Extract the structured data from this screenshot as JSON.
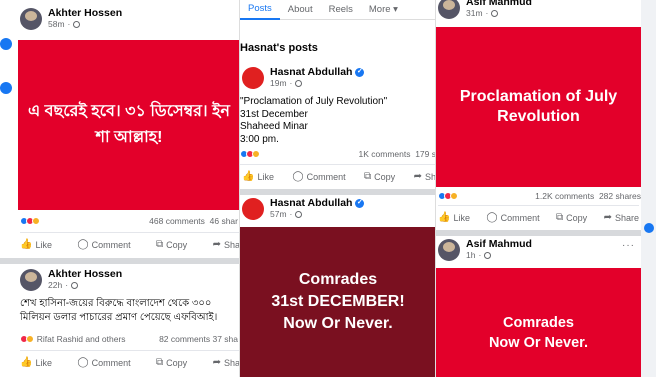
{
  "col1": {
    "post1": {
      "author": "Akhter Hossen",
      "time": "58m",
      "banner": "এ বছরেই হবে। ৩১ ডিসেম্বর। ইন শা আল্লাহ!",
      "comments": "468 comments",
      "shares": "46 shar"
    },
    "actions": {
      "like": "Like",
      "comment": "Comment",
      "copy": "Copy",
      "share": "Sha"
    },
    "post2": {
      "author": "Akhter Hossen",
      "time": "22h",
      "text": "শেখ হাসিনা-জয়ের বিরুদ্ধে বাংলাদেশ থেকে ৩০০ মিলিয়ন ডলার পাচারের প্রমাণ পেয়েছে এফবিআই।",
      "reactors": "Rifat Rashid and others",
      "comments": "82 comments",
      "shares": "37 sha"
    }
  },
  "col2": {
    "tabs": [
      "Posts",
      "About",
      "Reels",
      "More ▾"
    ],
    "section_title": "Hasnat's posts",
    "post1": {
      "author": "Hasnat Abdullah",
      "time": "19m",
      "text": "\"Proclamation of July Revolution\"\n31st December\nShaheed Minar\n3:00 pm.",
      "comments": "1K comments",
      "shares": "179 s"
    },
    "actions": {
      "like": "Like",
      "comment": "Comment",
      "copy": "Copy",
      "share": "Sh"
    },
    "post2": {
      "author": "Hasnat Abdullah",
      "time": "57m",
      "banner": "Comrades\n31st DECEMBER!\nNow Or Never."
    }
  },
  "col3": {
    "post1": {
      "author": "Asif Mahmud",
      "time": "31m",
      "banner": "Proclamation of July Revolution",
      "comments": "1.2K comments",
      "shares": "282 shares"
    },
    "actions": {
      "like": "Like",
      "comment": "Comment",
      "copy": "Copy",
      "share": "Share"
    },
    "post2": {
      "author": "Asif Mahmud",
      "time": "1h",
      "banner": "Comrades\nNow Or Never."
    }
  },
  "colors": {
    "red": "#e3002a",
    "maroon": "#7a1020",
    "link": "#1877f2",
    "muted": "#65676b"
  }
}
